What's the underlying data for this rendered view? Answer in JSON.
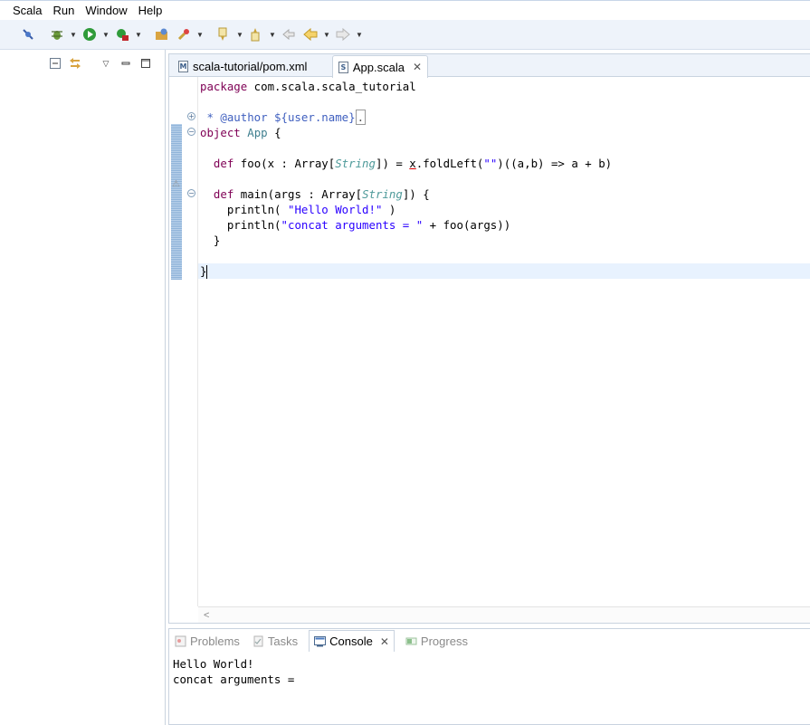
{
  "menu": [
    "Scala",
    "Run",
    "Window",
    "Help"
  ],
  "toolbar": {
    "buttons": [
      "breakpoint-skip-icon",
      "debug-icon",
      "run-icon",
      "external-tools-icon",
      "open-type-icon",
      "search-icon",
      "next-annotation-icon",
      "prev-annotation-icon",
      "last-edit-icon",
      "back-icon",
      "forward-icon"
    ]
  },
  "editor": {
    "tabs": [
      {
        "label": "scala-tutorial/pom.xml",
        "icon": "M"
      },
      {
        "label": "App.scala",
        "icon": "S"
      }
    ],
    "code": {
      "l1_kw": "package",
      "l1_rest": " com.scala.scala_tutorial",
      "l3_doc": " * @author ${user.name}",
      "l3_box": ".",
      "l4_kw": "object",
      "l4_name": "App",
      "l4_rest": " {",
      "l6_kw": "def",
      "l6_a": " foo(x : Array[",
      "l6_type": "String",
      "l6_b": "]) = ",
      "l6_x": "x",
      "l6_c": ".foldLeft(",
      "l6_str": "\"\"",
      "l6_d": ")((a,b) => a + b)",
      "l8_kw": "def",
      "l8_a": " main(args : Array[",
      "l8_type": "String",
      "l8_b": "]) {",
      "l9_a": "println( ",
      "l9_str": "\"Hello World!\"",
      "l9_b": " )",
      "l10_a": "println(",
      "l10_str": "\"concat arguments = \"",
      "l10_b": " + foo(args))",
      "l11": "}",
      "l13": "}"
    },
    "scroll_marker": "<"
  },
  "console": {
    "tabs": [
      "Problems",
      "Tasks",
      "Console",
      "Progress"
    ],
    "output": [
      "Hello World!",
      "concat arguments = "
    ]
  }
}
